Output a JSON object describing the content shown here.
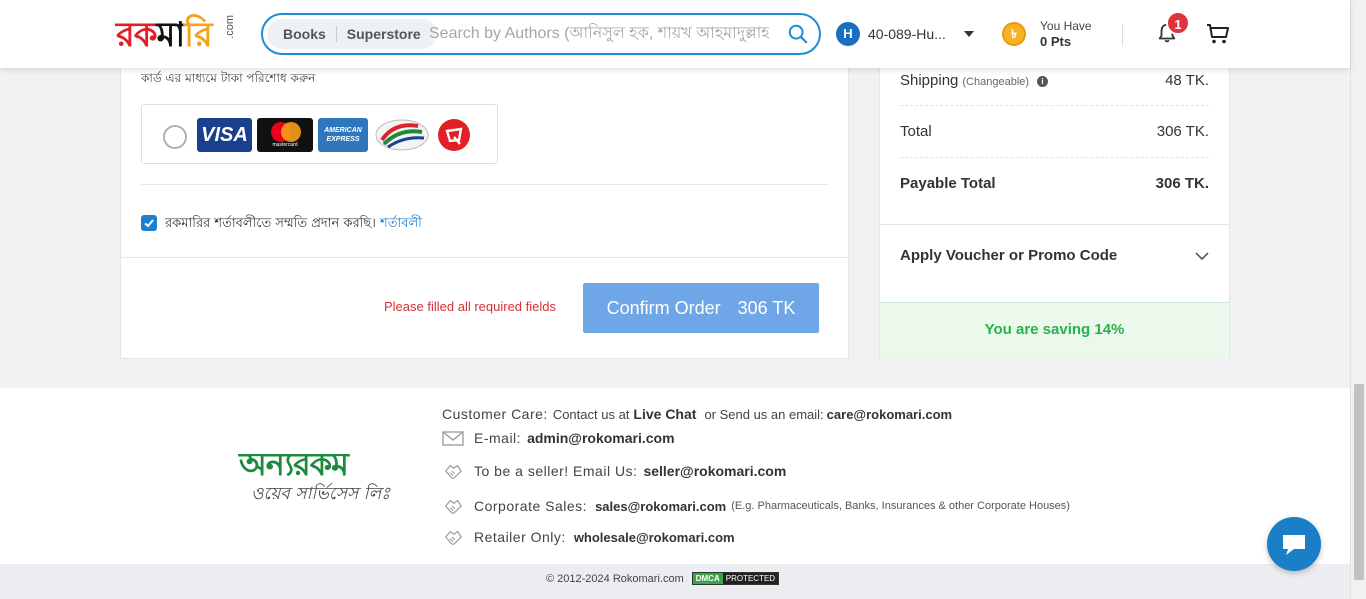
{
  "header": {
    "logo_text": "রকমারি",
    "logo_suffix": ".com",
    "search": {
      "tabs": [
        "Books",
        "Superstore"
      ],
      "placeholder": "Search by Authors (আনিসুল হক, শায়খ আহমাদুল্লাহ"
    },
    "user": {
      "initial": "H",
      "name": "40-089-Hu..."
    },
    "points": {
      "label": "You Have",
      "value": "0 Pts"
    },
    "notifications": {
      "count": "1"
    }
  },
  "payment": {
    "card_note": "কার্ড এর মাধ্যমে টাকা পরিশোধ করুন",
    "card_logos": [
      "visa-logo",
      "mastercard-logo",
      "amex-logo",
      "dbbl-nexus-logo",
      "nexuspay-logo"
    ],
    "visa_text": "VISA",
    "mastercard_text": "mastercard",
    "amex_text": "AMERICAN EXPRESS",
    "terms_text": "রকমারির শর্তাবলীতে সম্মতি প্রদান করছি।",
    "terms_link": "শর্তাবলী",
    "terms_checked": true,
    "error_message": "Please filled all required fields",
    "confirm_label": "Confirm Order",
    "confirm_amount": "306 TK"
  },
  "summary": {
    "shipping": {
      "label": "Shipping",
      "note": "(Changeable)",
      "value": "48 TK."
    },
    "total": {
      "label": "Total",
      "value": "306 TK."
    },
    "payable": {
      "label": "Payable Total",
      "value": "306 TK."
    },
    "voucher_label": "Apply Voucher or Promo Code",
    "saving_text": "You are saving 14%"
  },
  "footer": {
    "brand_main": "অন্যরকম",
    "brand_sub": "ওয়েব সার্ভিসেস লিঃ",
    "customer_care": {
      "label": "Customer  Care:",
      "contact_text": "Contact us at",
      "live_chat": "Live Chat",
      "or_text": "or Send us an email:",
      "email": "care@rokomari.com"
    },
    "email": {
      "label": "E-mail:",
      "value": "admin@rokomari.com"
    },
    "seller": {
      "label": "To be a seller! Email Us:",
      "value": "seller@rokomari.com"
    },
    "corporate": {
      "label": "Corporate Sales:",
      "value": "sales@rokomari.com",
      "note": "(E.g. Pharmaceuticals, Banks, Insurances & other Corporate Houses)"
    },
    "retailer": {
      "label": "Retailer Only:",
      "value": "wholesale@rokomari.com"
    },
    "copyright": "©  2012-2024  Rokomari.com",
    "dmca_a": "DMCA",
    "dmca_b": "PROTECTED"
  },
  "colors": {
    "primary": "#1b8fd2",
    "confirm_button": "#6fa6e8",
    "error": "#d43236",
    "saving_green": "#27b34a",
    "brand_green": "#1b8a3d"
  }
}
